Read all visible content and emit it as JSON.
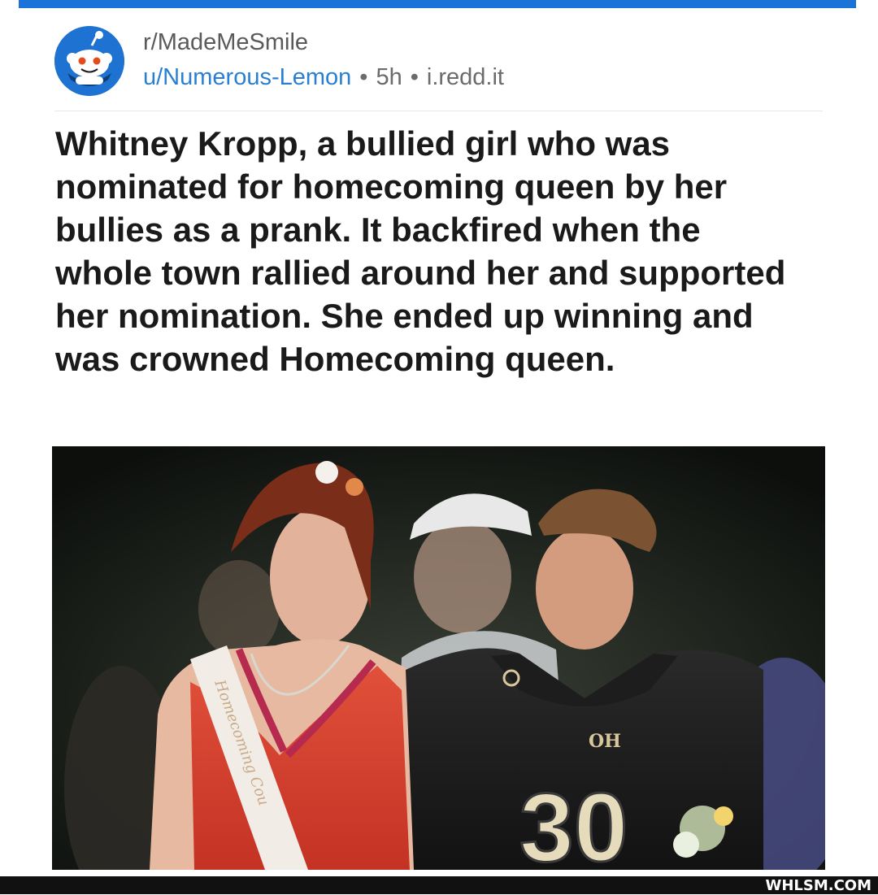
{
  "post": {
    "subreddit": "r/MadeMeSmile",
    "author": "u/Numerous-Lemon",
    "age": "5h",
    "domain": "i.redd.it",
    "separator": "•",
    "title": "Whitney Kropp, a bullied girl who was nominated for homecoming queen by her bullies as a prank. It backfired when the whole town rallied around her and supported her nomination. She ended up winning and was crowned Homecoming queen."
  },
  "image": {
    "sash_text": "Homecoming Cou",
    "jersey_logo": "OH",
    "jersey_number": "30"
  },
  "watermark": "WHLSM.COM",
  "colors": {
    "accent": "#1a73d9",
    "username": "#2a7fd3",
    "subreddit_text": "#5a5a5a"
  },
  "icons": {
    "avatar": "reddit-snoo-icon"
  }
}
